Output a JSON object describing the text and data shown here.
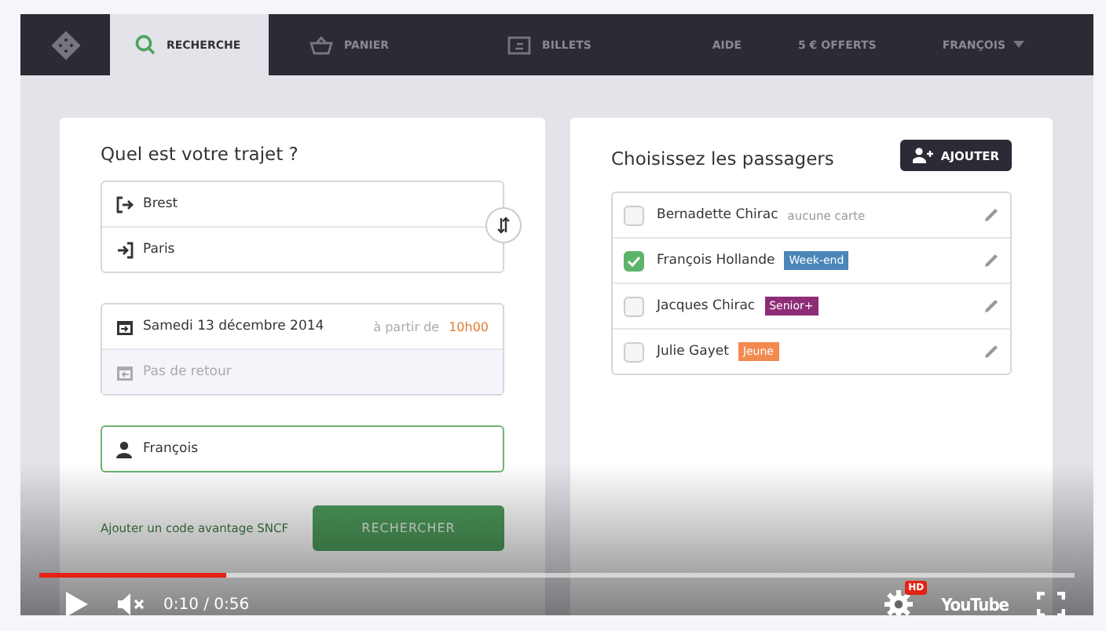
{
  "nav": {
    "tabs": [
      {
        "kind": "search",
        "label": "RECHERCHE",
        "selected": true
      },
      {
        "kind": "basket",
        "label": "PANIER",
        "selected": false
      },
      {
        "kind": "ticket",
        "label": "BILLETS",
        "selected": false
      }
    ],
    "links": [
      "AIDE",
      "5 € OFFERTS"
    ],
    "user": "FRANÇOIS"
  },
  "trip": {
    "title": "Quel est votre trajet ?",
    "origin": "Brest",
    "destination": "Paris",
    "outbound": {
      "date": "Samedi 13 décembre 2014",
      "from_label": "à partir de",
      "time": "10h00"
    },
    "return": {
      "placeholder": "Pas de retour"
    },
    "traveler": {
      "value": "François"
    },
    "promo_link": "Ajouter un code avantage SNCF",
    "search_button": "RECHERCHER"
  },
  "passengers": {
    "title": "Choisissez les passagers",
    "add_button": "AJOUTER",
    "items": [
      {
        "name": "Bernadette Chirac",
        "card": "aucune carte",
        "kind": "none",
        "checked": false
      },
      {
        "name": "François Hollande",
        "card": "Week-end",
        "kind": "tag",
        "color": "#4a86b8",
        "checked": true
      },
      {
        "name": "Jacques Chirac",
        "card": "Senior+",
        "kind": "tag",
        "color": "#8e2c78",
        "checked": false
      },
      {
        "name": "Julie Gayet",
        "card": "Jeune",
        "kind": "tag",
        "color": "#f28a50",
        "checked": false
      }
    ]
  },
  "player": {
    "level": 0.18,
    "time": "0:10 / 0:56",
    "hd": "HD",
    "logo": "YouTube"
  }
}
